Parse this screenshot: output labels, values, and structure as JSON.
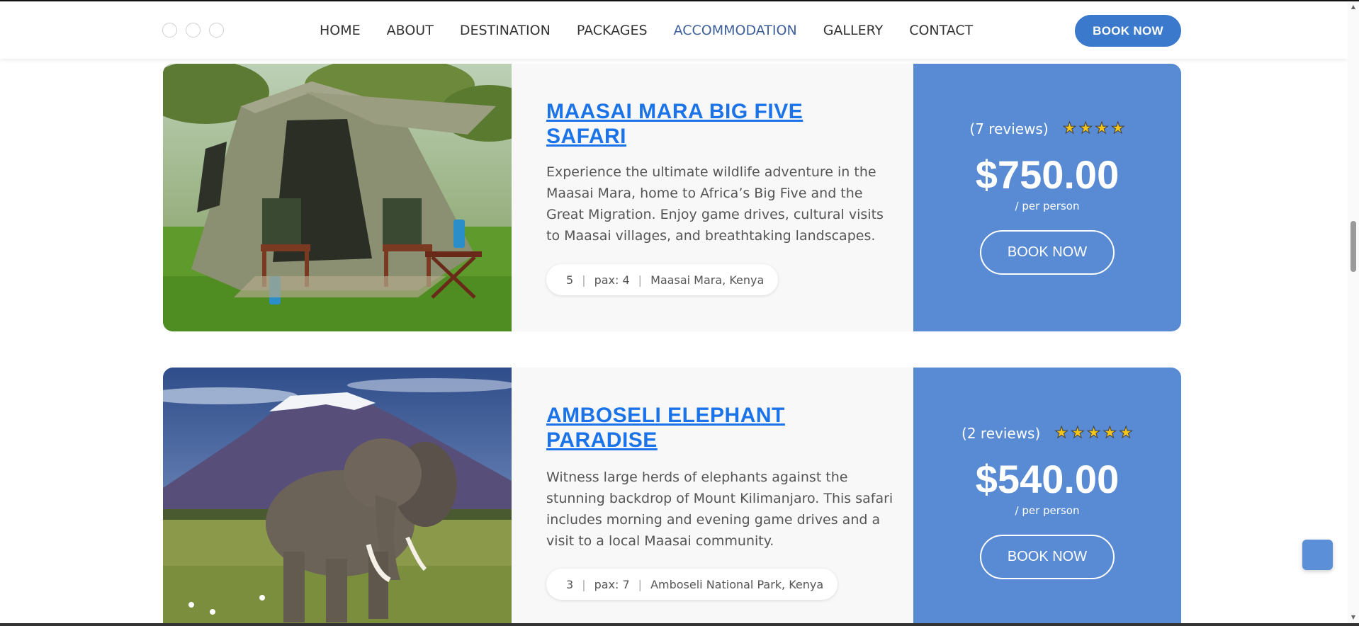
{
  "header": {
    "nav": [
      "HOME",
      "ABOUT",
      "DESTINATION",
      "PACKAGES",
      "ACCOMMODATION",
      "GALLERY",
      "CONTACT"
    ],
    "active": "ACCOMMODATION",
    "book_label": "BOOK NOW"
  },
  "packages": [
    {
      "title": "MAASAI MARA BIG FIVE SAFARI",
      "description": "Experience the ultimate wildlife adventure in the Maasai Mara, home to Africa’s Big Five and the Great Migration. Enjoy game drives, cultural visits to Maasai villages, and breathtaking landscapes.",
      "days": "5",
      "pax": "pax: 4",
      "location": "Maasai Mara, Kenya",
      "reviews": "(7 reviews)",
      "stars": 4,
      "price": "$750.00",
      "per": "/ per person",
      "book_label": "BOOK NOW",
      "image": "tent-photo"
    },
    {
      "title": "AMBOSELI ELEPHANT PARADISE",
      "description": "Witness large herds of elephants against the stunning backdrop of Mount Kilimanjaro. This safari includes morning and evening game drives and a visit to a local Maasai community.",
      "days": "3",
      "pax": "pax: 7",
      "location": "Amboseli National Park, Kenya",
      "reviews": "(2 reviews)",
      "stars": 5,
      "price": "$540.00",
      "per": "/ per person",
      "book_label": "BOOK NOW",
      "image": "elephant-photo"
    }
  ],
  "colors": {
    "accent": "#3a79cc",
    "price_panel": "#588bd3",
    "title_link": "#1a73e8",
    "active_nav": "#3d5f9a"
  }
}
